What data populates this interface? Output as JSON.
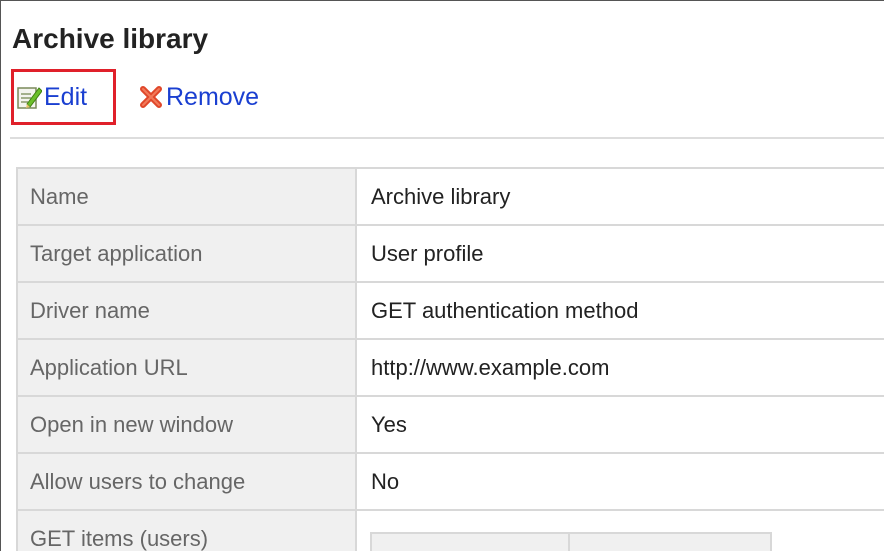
{
  "page": {
    "title": "Archive library"
  },
  "toolbar": {
    "edit_label": "Edit",
    "edit_icon": "edit-icon",
    "remove_label": "Remove",
    "remove_icon": "remove-icon",
    "highlight_color": "#e0202a",
    "link_color": "#1a3fd1"
  },
  "details": {
    "rows": [
      {
        "label": "Name",
        "value": "Archive library"
      },
      {
        "label": "Target application",
        "value": "User profile"
      },
      {
        "label": "Driver name",
        "value": "GET authentication method"
      },
      {
        "label": "Application URL",
        "value": "http://www.example.com"
      },
      {
        "label": "Open in new window",
        "value": "Yes"
      },
      {
        "label": "Allow users to change",
        "value": "No"
      },
      {
        "label": "GET items (users)",
        "value": ""
      }
    ]
  }
}
